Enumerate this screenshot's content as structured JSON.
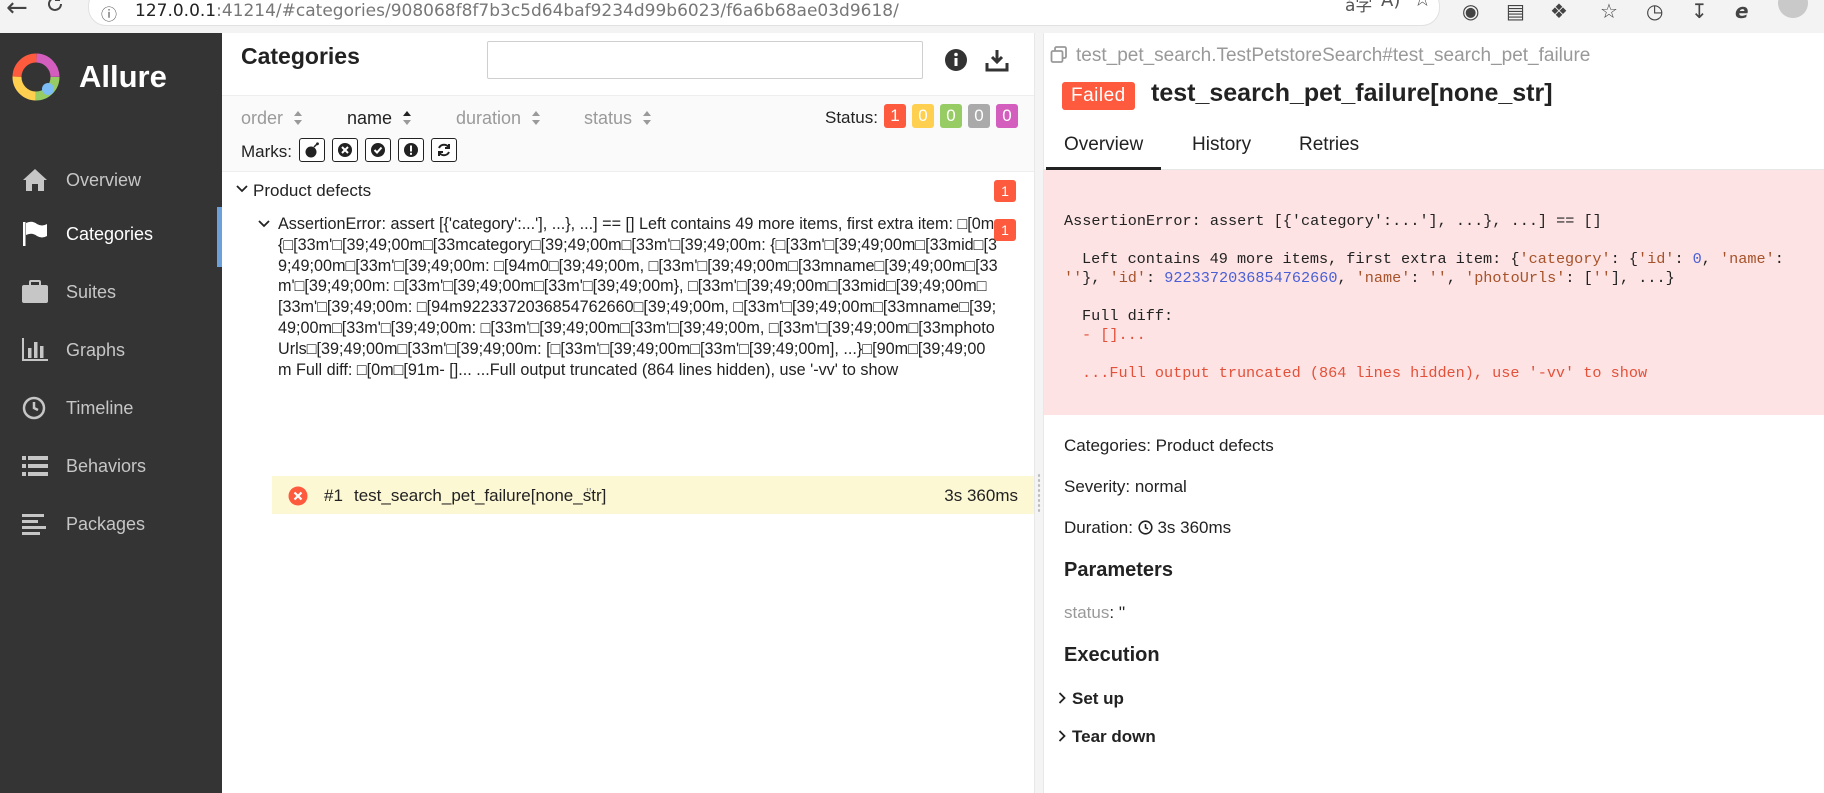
{
  "browser": {
    "url_host": "127.0.0.1",
    "url_rest": ":41214/#categories/908068f8f7b3c5d64baf9234d99b6023/f6a6b68ae03d9618/"
  },
  "sidebar": {
    "brand": "Allure",
    "items": [
      {
        "label": "Overview",
        "icon": "home-icon"
      },
      {
        "label": "Categories",
        "icon": "flag-icon"
      },
      {
        "label": "Suites",
        "icon": "briefcase-icon"
      },
      {
        "label": "Graphs",
        "icon": "bar-chart-icon"
      },
      {
        "label": "Timeline",
        "icon": "clock-icon"
      },
      {
        "label": "Behaviors",
        "icon": "list-icon"
      },
      {
        "label": "Packages",
        "icon": "align-left-icon"
      }
    ],
    "active_index": 1
  },
  "center": {
    "title": "Categories",
    "search": {
      "value": "",
      "placeholder": ""
    },
    "sorters": [
      {
        "label": "order",
        "active": false
      },
      {
        "label": "name",
        "active": true
      },
      {
        "label": "duration",
        "active": false
      },
      {
        "label": "status",
        "active": false
      }
    ],
    "status_label": "Status:",
    "status_counts": [
      {
        "status": "failed",
        "count": "1",
        "color": "#fd5a3e"
      },
      {
        "status": "broken",
        "count": "0",
        "color": "#ffd050"
      },
      {
        "status": "passed",
        "count": "0",
        "color": "#97cc64"
      },
      {
        "status": "skipped",
        "count": "0",
        "color": "#aaaaaa"
      },
      {
        "status": "unknown",
        "count": "0",
        "color": "#d35ebe"
      }
    ],
    "marks_label": "Marks:",
    "group": {
      "title": "Product defects",
      "count": "1"
    },
    "defect": {
      "count": "1",
      "message": "AssertionError: assert [{'category':...'], ...}, ...] == [] Left contains 49 more items, first extra item: □[0m{□[33m'□[39;49;00m□[33mcategory□[39;49;00m□[33m'□[39;49;00m: {□[33m'□[39;49;00m□[33mid□[39;49;00m□[33m'□[39;49;00m: □[94m0□[39;49;00m, □[33m'□[39;49;00m□[33mname□[39;49;00m□[33m'□[39;49;00m: □[33m'□[39;49;00m□[33m'□[39;49;00m}, □[33m'□[39;49;00m□[33mid□[39;49;00m□[33m'□[39;49;00m: □[94m9223372036854762660□[39;49;00m, □[33m'□[39;49;00m□[33mname□[39;49;00m□[33m'□[39;49;00m: □[33m'□[39;49;00m□[33m'□[39;49;00m, □[33m'□[39;49;00m□[33mphotoUrls□[39;49;00m□[33m'□[39;49;00m: [□[33m'□[39;49;00m□[33m'□[39;49;00m], ...}□[90m□[39;49;00m Full diff: □[0m□[91m- []... ...Full output truncated (864 lines hidden), use '-vv' to show"
    },
    "test_row": {
      "num": "#1",
      "name": "test_search_pet_failure[none_str]",
      "param": "''",
      "duration": "3s 360ms"
    }
  },
  "right": {
    "breadcrumb": "test_pet_search.TestPetstoreSearch#test_search_pet_failure",
    "status_badge": "Failed",
    "title": "test_search_pet_failure[none_str]",
    "tabs": [
      "Overview",
      "History",
      "Retries"
    ],
    "error": {
      "line1": "AssertionError: assert [{'category':...'], ...}, ...] == []",
      "line2_a": "Left contains 49 more items, first extra item: {",
      "line2_s1": "'category'",
      "line2_b": ": {",
      "line2_s2": "'id'",
      "line2_c": ": ",
      "line2_n1": "0",
      "line2_d": ", ",
      "line2_s3": "'name'",
      "line2_e": ":",
      "line3_s1": "''",
      "line3_a": "}, ",
      "line3_s2": "'id'",
      "line3_b": ": ",
      "line3_n1": "9223372036854762660",
      "line3_c": ", ",
      "line3_s3": "'name'",
      "line3_d": ": ",
      "line3_s4": "''",
      "line3_e": ", ",
      "line3_s5": "'photoUrls'",
      "line3_f": ": [",
      "line3_s6": "''",
      "line3_g": "], ...}",
      "diff_label": "Full diff:",
      "diff_line": "- []...",
      "truncated": "...Full output truncated (864 lines hidden), use '-vv' to show"
    },
    "categories_line": "Categories: Product defects",
    "severity_line": "Severity: normal",
    "duration_label": "Duration:",
    "duration_value": "3s 360ms",
    "parameters_heading": "Parameters",
    "param_key": "status",
    "param_value": ": ''",
    "execution_heading": "Execution",
    "steps": [
      "Set up",
      "Tear down"
    ]
  }
}
